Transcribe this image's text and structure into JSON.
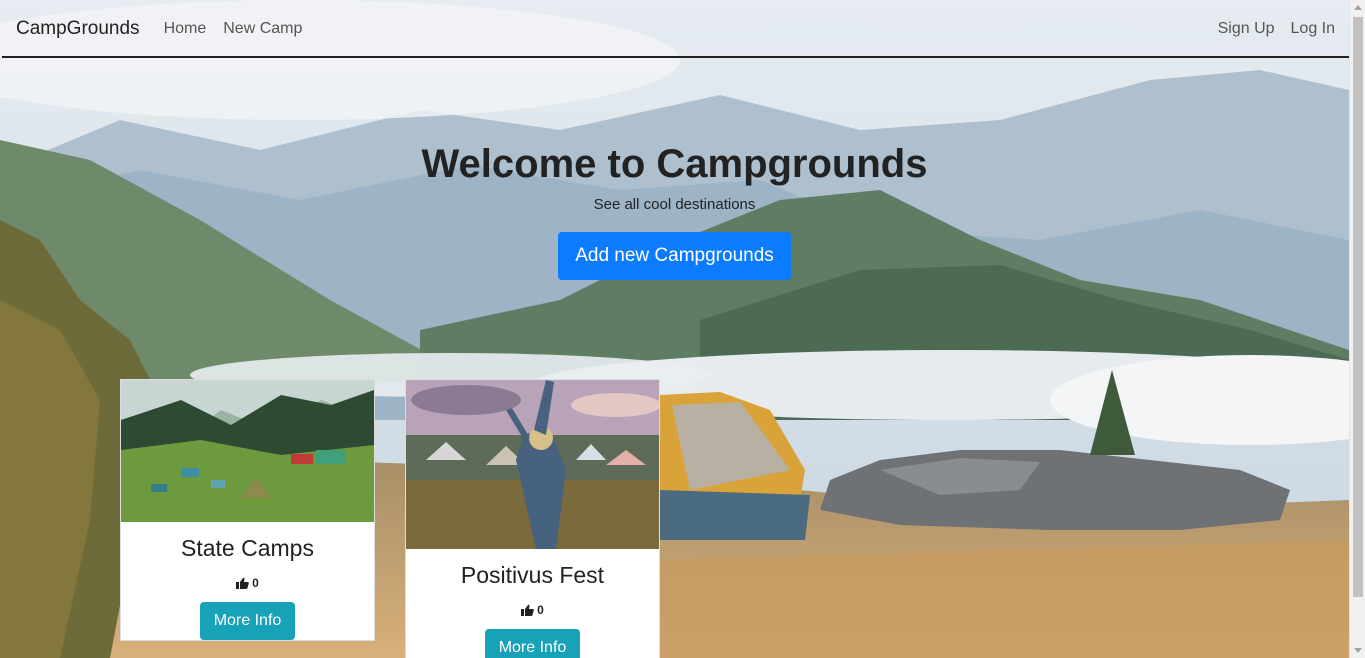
{
  "navbar": {
    "brand": "CampGrounds",
    "links": [
      "Home",
      "New Camp"
    ],
    "right_links": [
      "Sign Up",
      "Log In"
    ]
  },
  "hero": {
    "title": "Welcome to Campgrounds",
    "subtitle": "See all cool destinations",
    "button_label": "Add new Campgrounds"
  },
  "cards": [
    {
      "title": "State Camps",
      "likes": "0",
      "button_label": "More Info"
    },
    {
      "title": "Positivus Fest",
      "likes": "0",
      "button_label": "More Info"
    }
  ],
  "colors": {
    "primary_button": "#0d7bff",
    "info_button": "#17a2b8",
    "text": "#222222"
  },
  "icons": {
    "like": "thumbs-up-icon"
  }
}
